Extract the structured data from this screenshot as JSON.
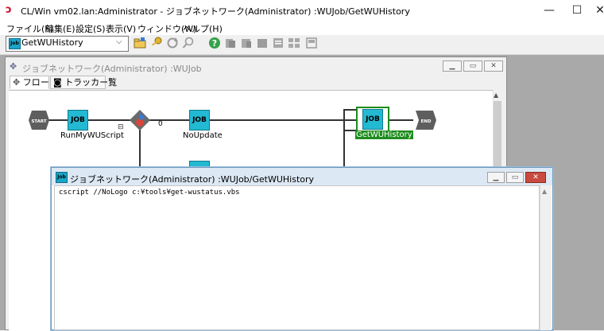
{
  "app": {
    "title": "CL/Win vm02.lan:Administrator - ジョブネットワーク(Administrator) :WUJob/GetWUHistory",
    "icon": "cl-win-logo-icon",
    "window_controls": {
      "minimize": "—",
      "maximize": "☐",
      "close": "✕"
    }
  },
  "menu": {
    "items": [
      "ファイル(F)",
      "編集(E)",
      "設定(S)",
      "表示(V)",
      "ウィンドウ(W)",
      "ヘルプ(H)"
    ]
  },
  "toolbar": {
    "job_select": {
      "icon_text": "Job",
      "value": "GetWUHistory"
    },
    "icons": [
      "open-folder-icon",
      "key-icon",
      "refresh-icon",
      "search-icon",
      "help-icon",
      "tool-icon-1",
      "tool-icon-2",
      "tool-icon-3",
      "tool-icon-4",
      "tool-icon-5",
      "tool-icon-6"
    ]
  },
  "jobnet_window": {
    "title": "ジョブネットワーク(Administrator) :WUJob",
    "tabs": [
      {
        "label": "フロー",
        "icon": "flow-icon"
      },
      {
        "label": "トラッカー覧",
        "icon": "tracker-icon"
      }
    ],
    "flow": {
      "start_label": "START",
      "end_label": "END",
      "job_icon_text": "JOB",
      "branch_value": "0",
      "collapse_symbol": "⊟",
      "nodes": [
        {
          "label": "RunMyWUScript"
        },
        {
          "label": "NoUpdate"
        },
        {
          "label": "GetWUHistory",
          "selected": true
        }
      ]
    }
  },
  "editor_window": {
    "icon_text": "Job",
    "title": "ジョブネットワーク(Administrator) :WUJob/GetWUHistory",
    "script": "cscript //NoLogo c:¥tools¥get-wustatus.vbs"
  },
  "colors": {
    "job_icon": "#23b9d3",
    "selected_node": "#1e8c1e",
    "close_button": "#c94a3f"
  }
}
